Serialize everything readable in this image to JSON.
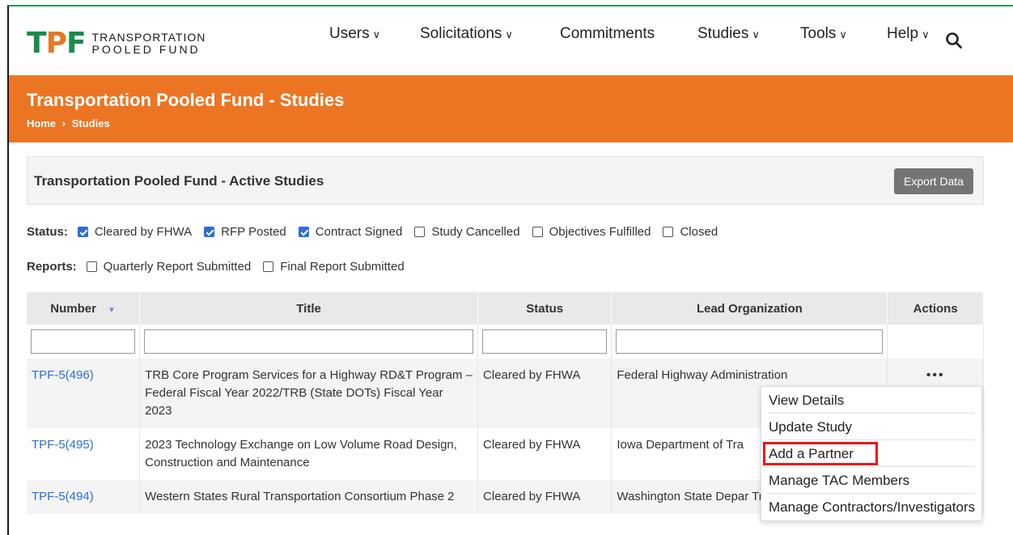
{
  "logo": {
    "mark": "TPF",
    "line1": "TRANSPORTATION",
    "line2": "POOLED FUND"
  },
  "nav": {
    "users": "Users",
    "solicitations": "Solicitations",
    "commitments": "Commitments",
    "studies": "Studies",
    "tools": "Tools",
    "help": "Help"
  },
  "banner": {
    "title": "Transportation Pooled Fund - Studies",
    "crumb_home": "Home",
    "crumb_sep": "›",
    "crumb_current": "Studies"
  },
  "panel": {
    "title": "Transportation Pooled Fund - Active Studies",
    "export_label": "Export Data"
  },
  "status_filter": {
    "label": "Status:",
    "options": [
      {
        "label": "Cleared by FHWA",
        "checked": true
      },
      {
        "label": "RFP Posted",
        "checked": true
      },
      {
        "label": "Contract Signed",
        "checked": true
      },
      {
        "label": "Study Cancelled",
        "checked": false
      },
      {
        "label": "Objectives Fulfilled",
        "checked": false
      },
      {
        "label": "Closed",
        "checked": false
      }
    ]
  },
  "reports_filter": {
    "label": "Reports:",
    "options": [
      {
        "label": "Quarterly Report Submitted",
        "checked": false
      },
      {
        "label": "Final Report Submitted",
        "checked": false
      }
    ]
  },
  "table": {
    "headers": [
      "Number",
      "Title",
      "Status",
      "Lead Organization",
      "Actions"
    ],
    "rows": [
      {
        "number": "TPF-5(496)",
        "title": "TRB Core Program Services for a Highway RD&T Program – Federal Fiscal Year 2022/TRB (State DOTs) Fiscal Year 2023",
        "status": "Cleared by FHWA",
        "lead": "Federal Highway Administration",
        "actions": "•••"
      },
      {
        "number": "TPF-5(495)",
        "title": "2023 Technology Exchange on Low Volume Road Design, Construction and Maintenance",
        "status": "Cleared by FHWA",
        "lead": "Iowa Department of Tra",
        "actions": ""
      },
      {
        "number": "TPF-5(494)",
        "title": "Western States Rural Transportation Consortium Phase 2",
        "status": "Cleared by FHWA",
        "lead": "Washington State Depar Transportation",
        "actions": ""
      }
    ]
  },
  "actions_menu": {
    "items": [
      "View Details",
      "Update Study",
      "Add a Partner",
      "Manage TAC Members",
      "Manage Contractors/Investigators"
    ],
    "highlighted_index": 2,
    "highlight_color": "#e8141b"
  },
  "colors": {
    "brand_green": "#1a8a4a",
    "brand_orange": "#ec7524",
    "link_blue": "#2b6fd6"
  }
}
